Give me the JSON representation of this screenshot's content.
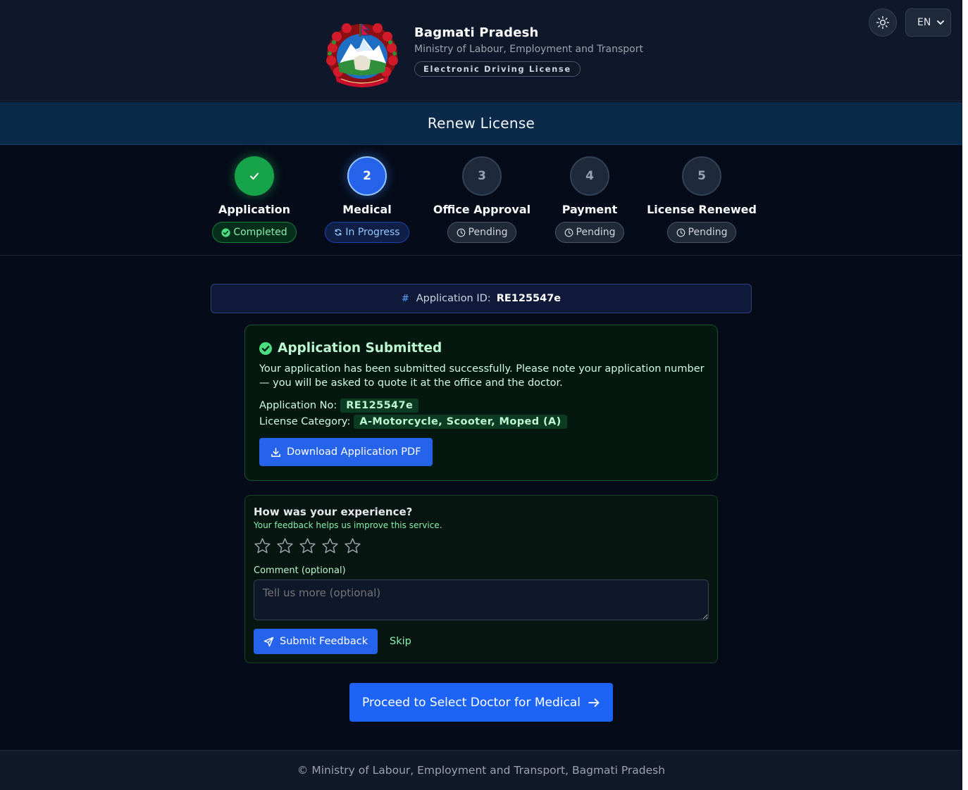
{
  "header": {
    "title": "Bagmati Pradesh",
    "subtitle": "Ministry of Labour, Employment and Transport",
    "pill": "Electronic Driving License",
    "language": "EN"
  },
  "page_title": "Renew License",
  "steps": [
    {
      "number": "✓",
      "label": "Application",
      "status": "Completed",
      "state": "done"
    },
    {
      "number": "2",
      "label": "Medical",
      "status": "In Progress",
      "state": "active"
    },
    {
      "number": "3",
      "label": "Office Approval",
      "status": "Pending",
      "state": "pending"
    },
    {
      "number": "4",
      "label": "Payment",
      "status": "Pending",
      "state": "pending"
    },
    {
      "number": "5",
      "label": "License Renewed",
      "status": "Pending",
      "state": "pending"
    }
  ],
  "application_id": {
    "label": "Application ID:",
    "value": "RE125547e"
  },
  "submitted": {
    "title": "Application Submitted",
    "message": "Your application has been submitted successfully. Please note your application number — you will be asked to quote it at the office and the doctor.",
    "app_no_label": "Application No:",
    "app_no_value": "RE125547e",
    "category_label": "License Category:",
    "category_value": "A-Motorcycle, Scooter, Moped (A)",
    "download_label": "Download Application PDF"
  },
  "feedback": {
    "question": "How was your experience?",
    "subtitle": "Your feedback helps us improve this service.",
    "rating": 0,
    "rating_max": 5,
    "comment_label": "Comment (optional)",
    "comment_placeholder": "Tell us more (optional)",
    "submit_label": "Submit Feedback",
    "skip_label": "Skip"
  },
  "proceed_label": "Proceed to Select Doctor for Medical",
  "footer": "© Ministry of Labour, Employment and Transport, Bagmati Pradesh",
  "colors": {
    "primary": "#2563eb",
    "success": "#16a34a",
    "background": "#050b18"
  }
}
